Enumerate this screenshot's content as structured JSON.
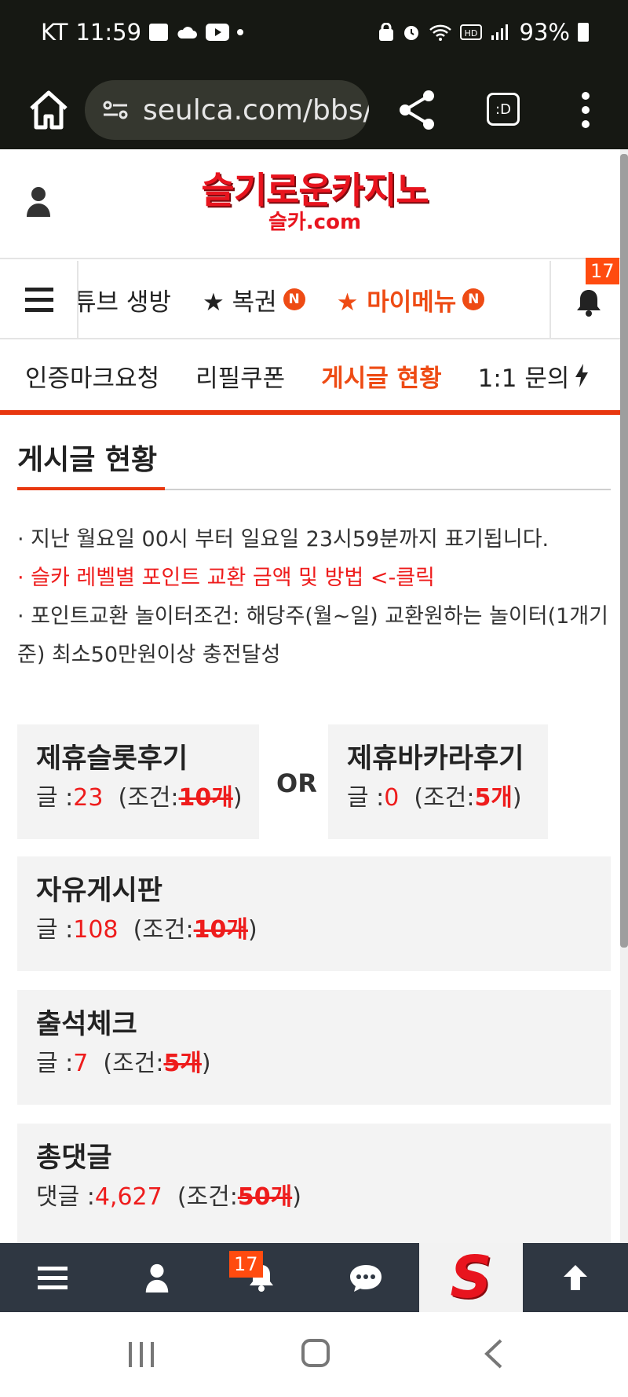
{
  "status_bar": {
    "carrier": "KT",
    "time": "11:59",
    "battery": "93%"
  },
  "browser": {
    "url": "seulca.com/bbs/",
    "tabs_label": ":D"
  },
  "header": {
    "logo_main": "슬기로운카지노",
    "logo_sub": "슬카.com"
  },
  "nav": {
    "items": [
      {
        "label": "튜브 생방"
      },
      {
        "label": "★ 복권",
        "badge": "N"
      },
      {
        "label": "★ 마이메뉴",
        "badge": "N"
      }
    ],
    "bell_count": "17"
  },
  "subtabs": [
    {
      "label": "인증마크요청"
    },
    {
      "label": "리필쿠폰"
    },
    {
      "label": "게시글 현황"
    },
    {
      "label": "1:1 문의"
    }
  ],
  "page": {
    "title": "게시글 현황",
    "notices": [
      "· 지난 월요일 00시 부터 일요일 23시59분까지 표기됩니다.",
      "· 슬카 레벨별 포인트 교환 금액 및 방법 <-클릭",
      "· 포인트교환 놀이터조건: 해당주(월~일) 교환원하는 놀이터(1개기준) 최소50만원이상 충전달성"
    ]
  },
  "cards": [
    {
      "title": "제휴슬롯후기",
      "prefix": "글 :",
      "value": "23",
      "cond_prefix": "(조건:",
      "cond_value": "10개",
      "cond_suffix": ")"
    },
    {
      "title": "제휴바카라후기",
      "prefix": "글 :",
      "value": "0",
      "cond_prefix": "(조건:",
      "cond_value": "5개",
      "cond_suffix": ")"
    },
    {
      "title": "자유게시판",
      "prefix": "글 :",
      "value": "108",
      "cond_prefix": "(조건:",
      "cond_value": "10개",
      "cond_suffix": ")"
    },
    {
      "title": "출석체크",
      "prefix": "글 :",
      "value": "7",
      "cond_prefix": "(조건:",
      "cond_value": "5개",
      "cond_suffix": ")"
    },
    {
      "title": "총댓글",
      "prefix": "댓글 :",
      "value": "4,627",
      "cond_prefix": "(조건:",
      "cond_value": "50개",
      "cond_suffix": ")"
    }
  ],
  "or_label": "OR",
  "bottom_bar": {
    "bell_count": "17",
    "logo_mark": "S"
  },
  "colors": {
    "accent": "#ee4b14",
    "red": "#ee1c1c",
    "bottom_bar": "#2f3742",
    "status_bg": "#161813"
  }
}
